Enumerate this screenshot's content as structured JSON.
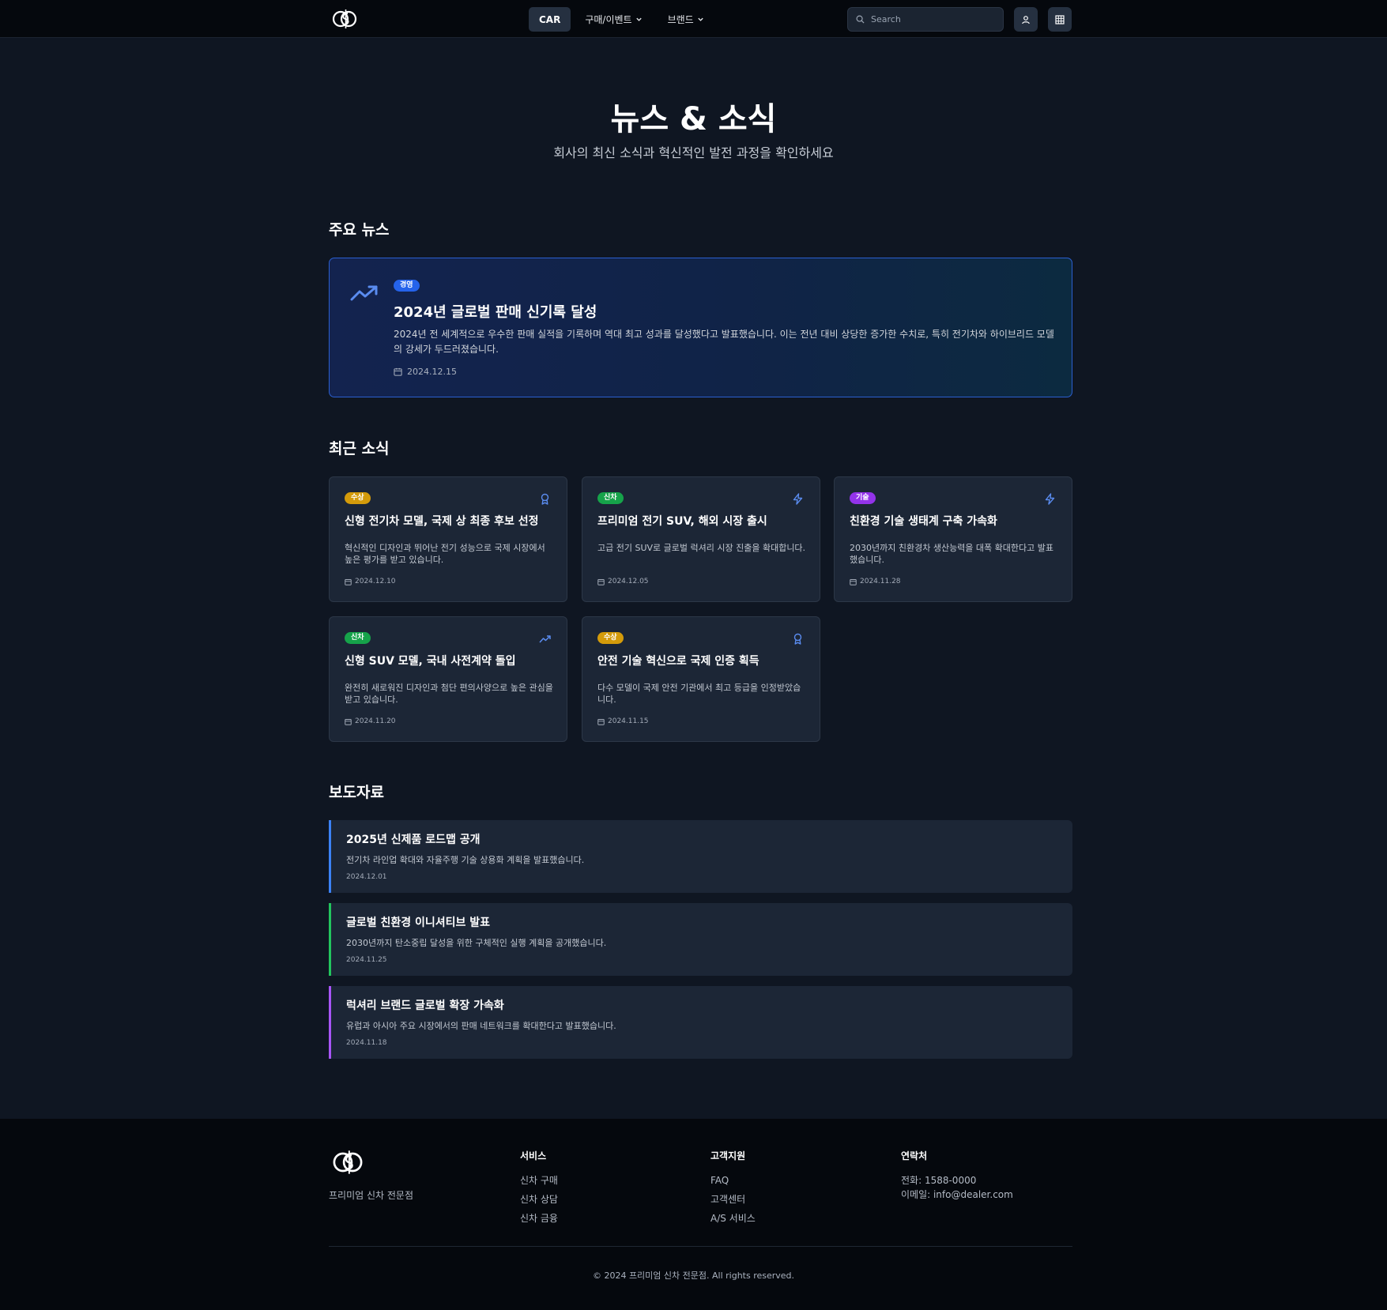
{
  "header": {
    "nav_car": "CAR",
    "nav_buy": "구매/이벤트",
    "nav_brand": "브랜드",
    "search_placeholder": "Search"
  },
  "hero": {
    "title": "뉴스 & 소식",
    "subtitle": "회사의 최신 소식과 혁신적인 발전 과정을 확인하세요"
  },
  "sections": {
    "featured_heading": "주요 뉴스",
    "recent_heading": "최근 소식",
    "press_heading": "보도자료"
  },
  "featured": {
    "badge": "경영",
    "title": "2024년 글로벌 판매 신기록 달성",
    "description": "2024년 전 세계적으로 우수한 판매 실적을 기록하며 역대 최고 성과를 달성했다고 발표했습니다. 이는 전년 대비 상당한 증가한 수치로, 특히 전기차와 하이브리드 모델의 강세가 두드러졌습니다.",
    "date": "2024.12.15",
    "icon": "trending-up-icon"
  },
  "cards": [
    {
      "badge": "수상",
      "badge_color": "#d49b0a",
      "icon": "award-icon",
      "title": "신형 전기차 모델, 국제 상 최종 후보 선정",
      "description": "혁신적인 디자인과 뛰어난 전기 성능으로 국제 시장에서 높은 평가를 받고 있습니다.",
      "date": "2024.12.10"
    },
    {
      "badge": "신차",
      "badge_color": "#16a34a",
      "icon": "zap-icon",
      "title": "프리미엄 전기 SUV, 해외 시장 출시",
      "description": "고급 전기 SUV로 글로벌 럭셔리 시장 진출을 확대합니다.",
      "date": "2024.12.05"
    },
    {
      "badge": "기술",
      "badge_color": "#9333ea",
      "icon": "zap-icon",
      "title": "친환경 기술 생태계 구축 가속화",
      "description": "2030년까지 친환경차 생산능력을 대폭 확대한다고 발표했습니다.",
      "date": "2024.11.28"
    },
    {
      "badge": "신차",
      "badge_color": "#16a34a",
      "icon": "trending-up-icon",
      "title": "신형 SUV 모델, 국내 사전계약 돌입",
      "description": "완전히 새로워진 디자인과 첨단 편의사양으로 높은 관심을 받고 있습니다.",
      "date": "2024.11.20"
    },
    {
      "badge": "수상",
      "badge_color": "#d49b0a",
      "icon": "award-icon",
      "title": "안전 기술 혁신으로 국제 인증 획득",
      "description": "다수 모델이 국제 안전 기관에서 최고 등급을 인정받았습니다.",
      "date": "2024.11.15"
    }
  ],
  "press": [
    {
      "title": "2025년 신제품 로드맵 공개",
      "description": "전기차 라인업 확대와 자율주행 기술 상용화 계획을 발표했습니다.",
      "date": "2024.12.01",
      "accent": "#3b82f6"
    },
    {
      "title": "글로벌 친환경 이니셔티브 발표",
      "description": "2030년까지 탄소중립 달성을 위한 구체적인 실행 계획을 공개했습니다.",
      "date": "2024.11.25",
      "accent": "#22c55e"
    },
    {
      "title": "럭셔리 브랜드 글로벌 확장 가속화",
      "description": "유럽과 아시아 주요 시장에서의 판매 네트워크를 확대한다고 발표했습니다.",
      "date": "2024.11.18",
      "accent": "#a855f7"
    }
  ],
  "footer": {
    "tagline": "프리미엄 신차 전문점",
    "services_heading": "서비스",
    "services": [
      "신차 구매",
      "신차 상담",
      "신차 금융"
    ],
    "support_heading": "고객지원",
    "support": [
      "FAQ",
      "고객센터",
      "A/S 서비스"
    ],
    "contact_heading": "연락처",
    "phone": "전화: 1588-0000",
    "email": "이메일: info@dealer.com",
    "copyright": "© 2024 프리미엄 신차 전문점. All rights reserved."
  }
}
